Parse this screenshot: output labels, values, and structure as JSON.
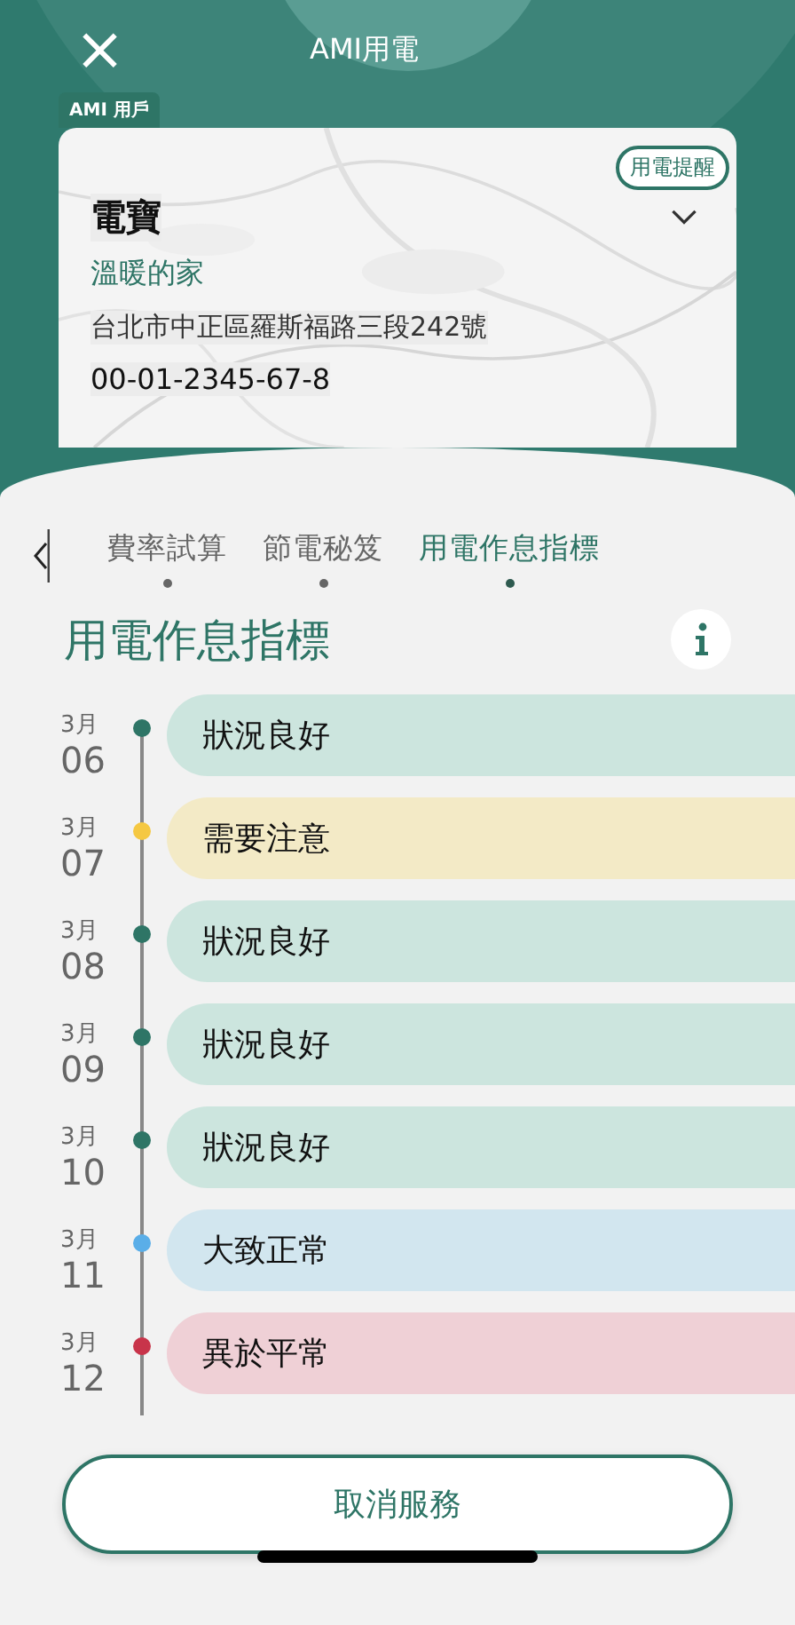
{
  "header": {
    "close_icon": "×",
    "title": "AMI用電"
  },
  "account_tag": "AMI 用戶",
  "card": {
    "reminder_button": "用電提醒",
    "name": "電寶",
    "nickname": "溫暖的家",
    "address": "台北市中正區羅斯福路三段242號",
    "account_number": "00-01-2345-67-8"
  },
  "tabs": [
    {
      "label": "費率試算",
      "selected": false
    },
    {
      "label": "節電秘笈",
      "selected": false
    },
    {
      "label": "用電作息指標",
      "selected": true
    }
  ],
  "section": {
    "title": "用電作息指標"
  },
  "timeline": [
    {
      "month": "3月",
      "day": "06",
      "status": "狀況良好",
      "kind": "good",
      "color": "#2e7566"
    },
    {
      "month": "3月",
      "day": "07",
      "status": "需要注意",
      "kind": "caution",
      "color": "#f5c842"
    },
    {
      "month": "3月",
      "day": "08",
      "status": "狀況良好",
      "kind": "good",
      "color": "#2e7566"
    },
    {
      "month": "3月",
      "day": "09",
      "status": "狀況良好",
      "kind": "good",
      "color": "#2e7566"
    },
    {
      "month": "3月",
      "day": "10",
      "status": "狀況良好",
      "kind": "good",
      "color": "#2e7566"
    },
    {
      "month": "3月",
      "day": "11",
      "status": "大致正常",
      "kind": "normal",
      "color": "#5aaee8"
    },
    {
      "month": "3月",
      "day": "12",
      "status": "異於平常",
      "kind": "abnormal",
      "color": "#c8344a"
    }
  ],
  "cancel_button": "取消服務"
}
